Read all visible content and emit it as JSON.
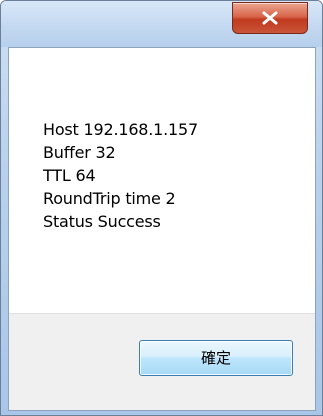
{
  "window": {
    "close_icon": "close-icon"
  },
  "message": {
    "lines": [
      "Host 192.168.1.157",
      "Buffer 32",
      "TTL 64",
      "RoundTrip time 2",
      "Status Success"
    ]
  },
  "buttons": {
    "ok_label": "確定"
  },
  "colors": {
    "close_button": "#c9553a",
    "ok_border": "#3c7fb1",
    "footer_bg": "#f0f0f0"
  }
}
